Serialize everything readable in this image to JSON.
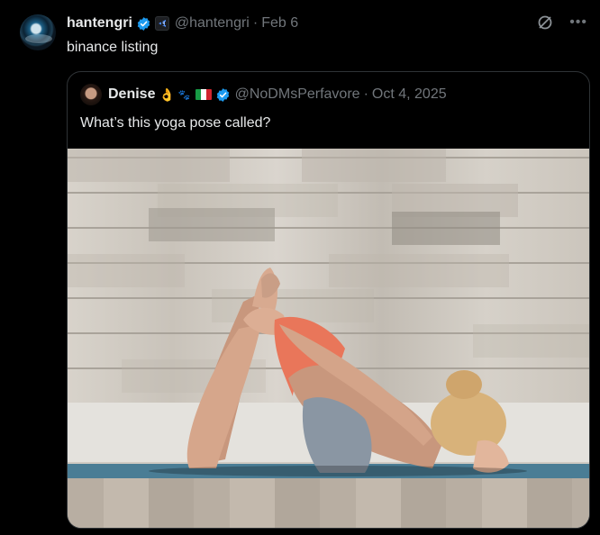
{
  "post": {
    "author_name": "hantengri",
    "author_handle": "@hantengri",
    "separator": "·",
    "date": "Feb 6",
    "text": "binance listing"
  },
  "quote": {
    "author_name": "Denise",
    "author_emojis": "👌",
    "paws": "🐾",
    "author_handle": "@NoDMsPerfavore",
    "separator": "·",
    "date": "Oct 4, 2025",
    "text": "What’s this yoga pose called?"
  },
  "icons": {
    "verified": "verified-badge-icon",
    "affiliate": "affiliate-badge-icon",
    "grok": "grok-icon",
    "more": "more-icon"
  },
  "colors": {
    "verified_blue": "#1d9bf0",
    "muted": "#71767b",
    "background": "#000000",
    "border": "#2f3336"
  }
}
